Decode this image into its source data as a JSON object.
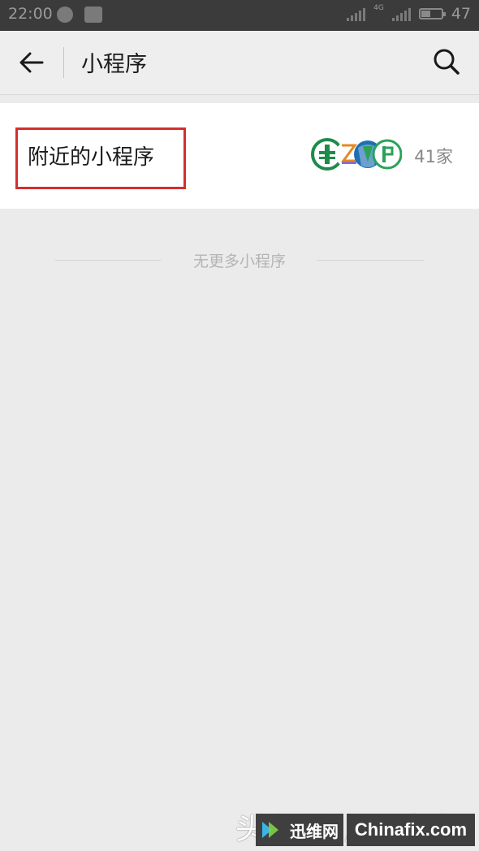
{
  "status_bar": {
    "time": "22:00",
    "network": "4G",
    "battery": "47",
    "battery_level": 0.47
  },
  "nav": {
    "title": "小程序",
    "back_icon": "arrow-left-icon",
    "search_icon": "search-icon"
  },
  "nearby": {
    "label": "附近的小程序",
    "count": "41家",
    "highlight_color": "#d32f2f"
  },
  "list_end": {
    "text": "无更多小程序"
  },
  "watermark": {
    "text": "头条号 / 阿兔柘",
    "logo_text": "迅维网",
    "site": "Chinafix.com"
  }
}
